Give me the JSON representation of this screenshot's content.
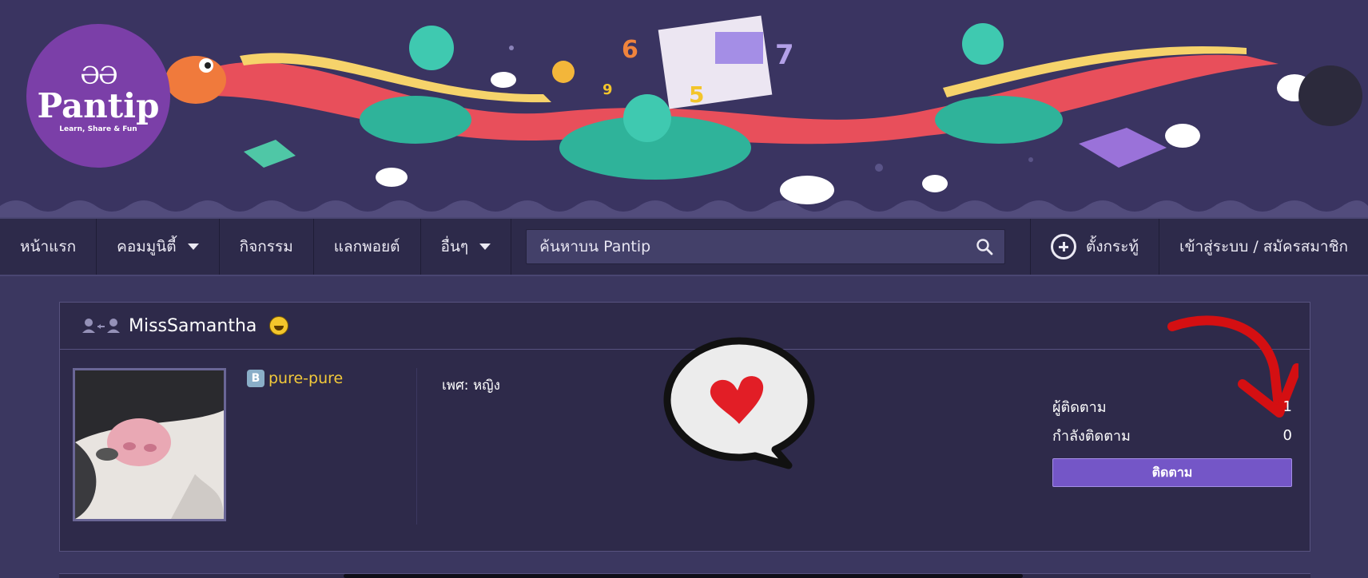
{
  "banner": {
    "logo": {
      "glyph": "ƏƏ",
      "name": "Pantip",
      "tagline": "Learn, Share & Fun"
    }
  },
  "nav": {
    "home": "หน้าแรก",
    "community": "คอมมูนิตี้",
    "activities": "กิจกรรม",
    "redeem": "แลกพอยต์",
    "more": "อื่นๆ",
    "search_placeholder": "ค้นหาบน Pantip",
    "new_topic": "ตั้งกระทู้",
    "login": "เข้าสู่ระบบ / สมัครสมาชิก"
  },
  "profile": {
    "username": "MissSamantha",
    "member_badge": "B",
    "member_name": "pure-pure",
    "gender": "เพศ: หญิง",
    "followers_label": "ผู้ติดตาม",
    "followers_count": "1",
    "following_label": "กำลังติดตาม",
    "following_count": "0",
    "follow_button": "ติดตาม"
  },
  "colors": {
    "background": "#3b3760",
    "nav_bg": "#2d2a4a",
    "card_bg": "#2e2a4a",
    "accent": "#7456c7",
    "member_name": "#f2c93a",
    "annotation_red": "#d40f12"
  }
}
